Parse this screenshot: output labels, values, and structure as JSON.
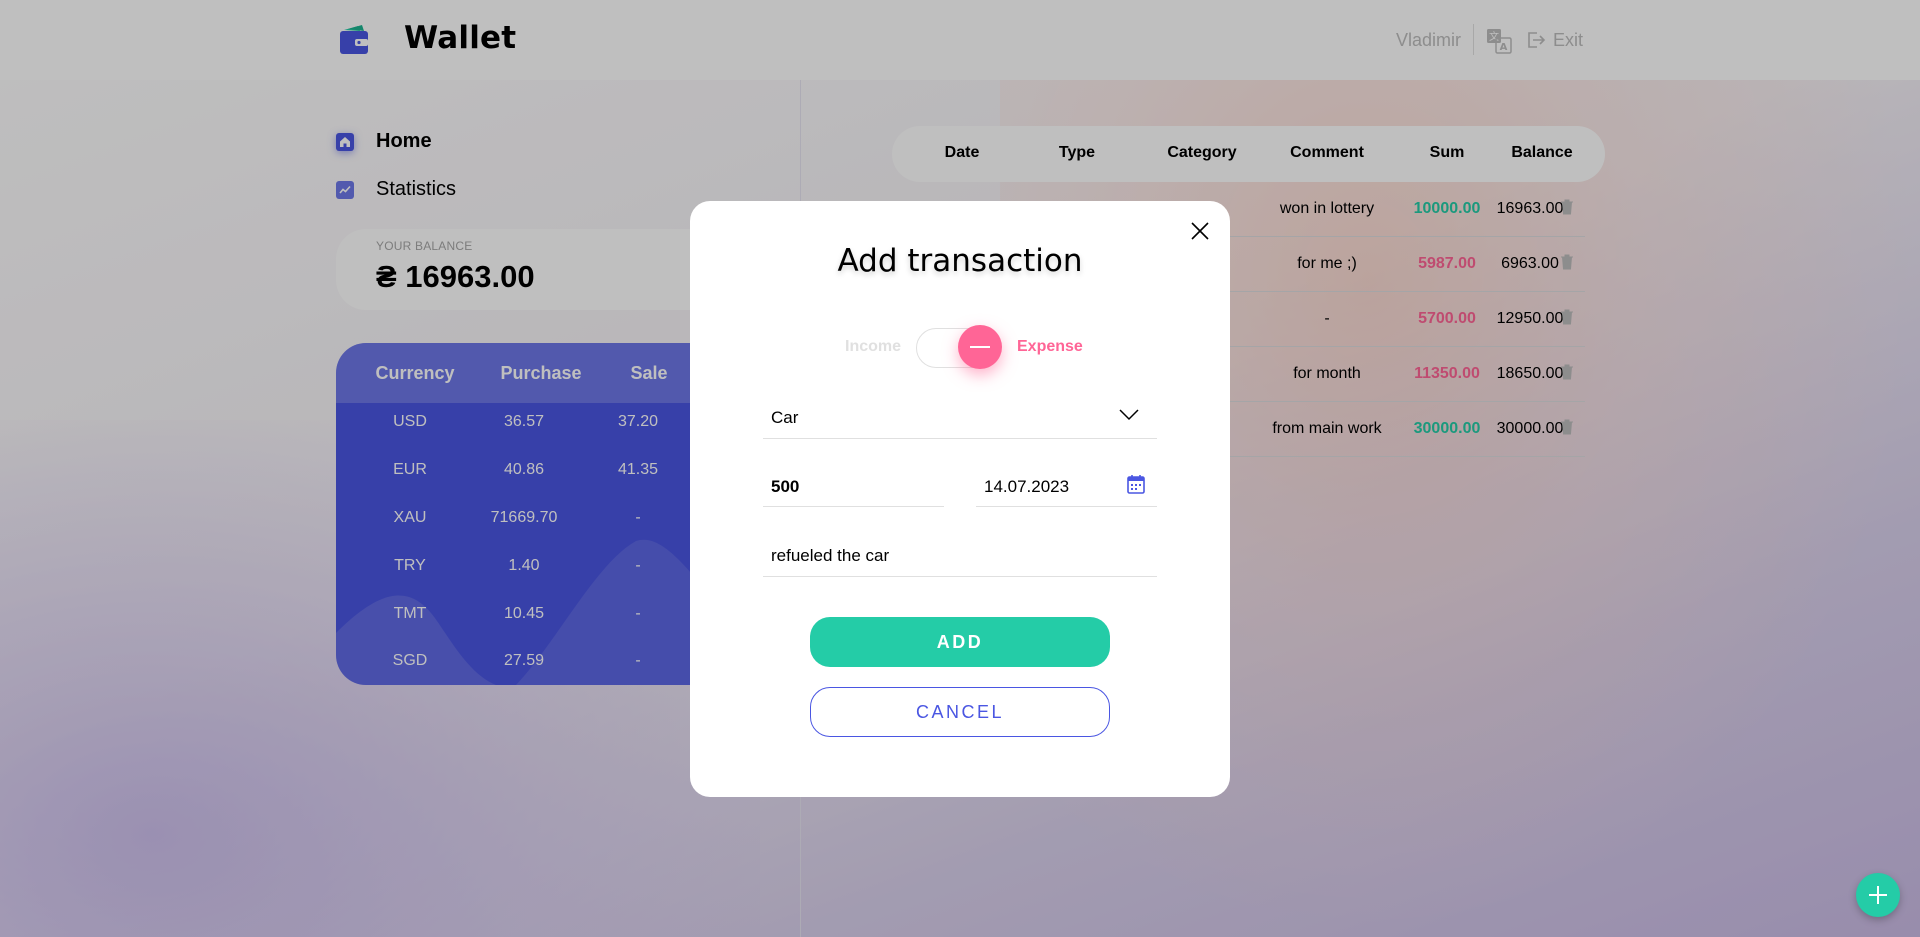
{
  "app": {
    "title": "Wallet"
  },
  "header": {
    "user_name": "Vladimir",
    "exit_label": "Exit"
  },
  "nav": {
    "items": [
      {
        "label": "Home",
        "icon": "home-icon"
      },
      {
        "label": "Statistics",
        "icon": "statistics-icon"
      }
    ]
  },
  "balance": {
    "caption": "YOUR BALANCE",
    "currency_symbol": "₴",
    "amount": "16963.00",
    "display": "₴ 16963.00"
  },
  "currency": {
    "headers": [
      "Currency",
      "Purchase",
      "Sale"
    ],
    "rows": [
      [
        "USD",
        "36.57",
        "37.20"
      ],
      [
        "EUR",
        "40.86",
        "41.35"
      ],
      [
        "XAU",
        "71669.70",
        "-"
      ],
      [
        "TRY",
        "1.40",
        "-"
      ],
      [
        "TMT",
        "10.45",
        "-"
      ],
      [
        "SGD",
        "27.59",
        "-"
      ]
    ]
  },
  "table": {
    "headers": [
      "Date",
      "Type",
      "Category",
      "Comment",
      "Sum",
      "Balance"
    ],
    "rows": [
      {
        "comment": "won in lottery",
        "sum": "10000.00",
        "balance": "16963.00",
        "kind": "income"
      },
      {
        "comment": "for me ;)",
        "sum": "5987.00",
        "balance": "6963.00",
        "kind": "expense"
      },
      {
        "comment": "-",
        "sum": "5700.00",
        "balance": "12950.00",
        "kind": "expense"
      },
      {
        "comment": "for month",
        "sum": "11350.00",
        "balance": "18650.00",
        "kind": "expense"
      },
      {
        "comment": "from main work",
        "sum": "30000.00",
        "balance": "30000.00",
        "kind": "income"
      }
    ]
  },
  "modal": {
    "title": "Add transaction",
    "income_label": "Income",
    "expense_label": "Expense",
    "selected_type": "Expense",
    "category_value": "Car",
    "amount_value": "500",
    "date_value": "14.07.2023",
    "comment_value": "refueled the car",
    "add_label": "ADD",
    "cancel_label": "CANCEL"
  },
  "colors": {
    "accent": "#4a56e2",
    "income": "#24cca7",
    "expense": "#ff6596"
  }
}
